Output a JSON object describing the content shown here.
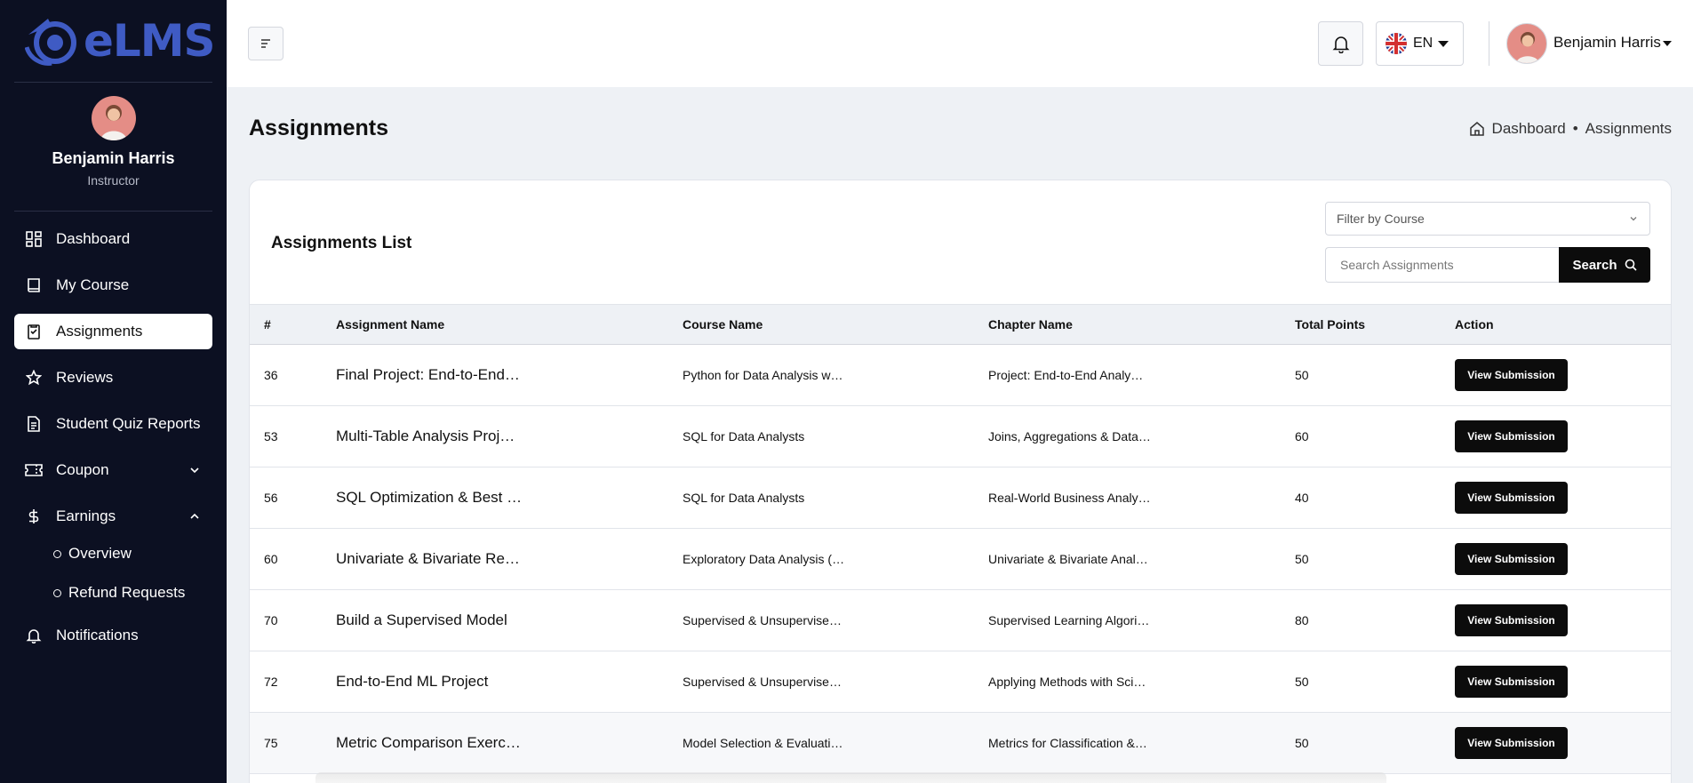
{
  "app": {
    "logo_text": "eLMS"
  },
  "sidebar": {
    "user_name": "Benjamin Harris",
    "user_role": "Instructor",
    "items": [
      {
        "label": "Dashboard",
        "icon": "dashboard-icon"
      },
      {
        "label": "My Course",
        "icon": "book-icon"
      },
      {
        "label": "Assignments",
        "icon": "assignment-icon",
        "active": true
      },
      {
        "label": "Reviews",
        "icon": "star-icon"
      },
      {
        "label": "Student Quiz Reports",
        "icon": "report-icon"
      },
      {
        "label": "Coupon",
        "icon": "ticket-icon",
        "expandable": true,
        "expanded": false
      },
      {
        "label": "Earnings",
        "icon": "dollar-icon",
        "expandable": true,
        "expanded": true
      },
      {
        "label": "Notifications",
        "icon": "bell-icon"
      }
    ],
    "earnings_sub": [
      {
        "label": "Overview"
      },
      {
        "label": "Refund Requests"
      }
    ]
  },
  "header": {
    "language": "EN",
    "user_name": "Benjamin Harris"
  },
  "page": {
    "title": "Assignments",
    "breadcrumb": {
      "home": "Dashboard",
      "current": "Assignments",
      "separator": "•"
    }
  },
  "card": {
    "title": "Assignments List",
    "filter_placeholder": "Filter by Course",
    "search_placeholder": "Search Assignments",
    "search_label": "Search"
  },
  "table": {
    "columns": [
      "#",
      "Assignment Name",
      "Course Name",
      "Chapter Name",
      "Total Points",
      "Action"
    ],
    "action_label": "View Submission",
    "rows": [
      {
        "id": "36",
        "name": "Final Project: End-to-End…",
        "course": "Python for Data Analysis w…",
        "chapter": "Project: End-to-End Analy…",
        "points": "50"
      },
      {
        "id": "53",
        "name": "Multi-Table Analysis Proj…",
        "course": "SQL for Data Analysts",
        "chapter": "Joins, Aggregations & Data…",
        "points": "60"
      },
      {
        "id": "56",
        "name": "SQL Optimization & Best …",
        "course": "SQL for Data Analysts",
        "chapter": "Real-World Business Analy…",
        "points": "40"
      },
      {
        "id": "60",
        "name": "Univariate & Bivariate Re…",
        "course": "Exploratory Data Analysis (…",
        "chapter": "Univariate & Bivariate Anal…",
        "points": "50"
      },
      {
        "id": "70",
        "name": "Build a Supervised Model",
        "course": "Supervised & Unsupervise…",
        "chapter": "Supervised Learning Algori…",
        "points": "80"
      },
      {
        "id": "72",
        "name": "End-to-End ML Project",
        "course": "Supervised & Unsupervise…",
        "chapter": "Applying Methods with Sci…",
        "points": "50"
      },
      {
        "id": "75",
        "name": "Metric Comparison Exerc…",
        "course": "Model Selection & Evaluati…",
        "chapter": "Metrics for Classification &…",
        "points": "50"
      }
    ]
  }
}
